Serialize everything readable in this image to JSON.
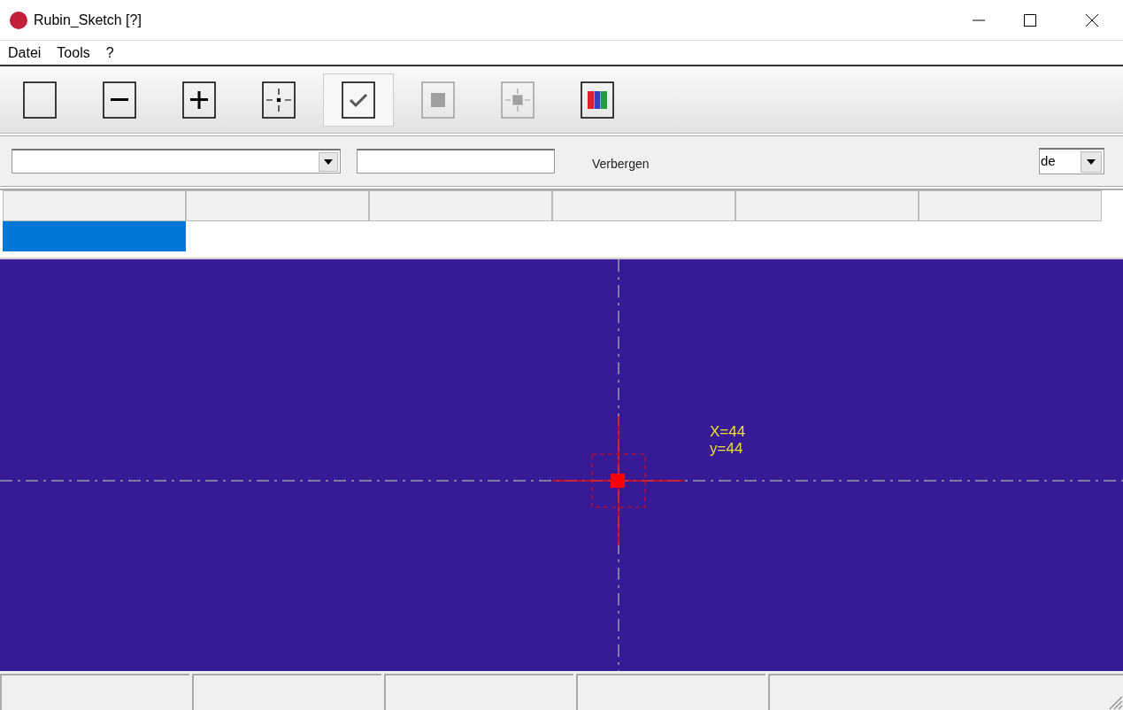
{
  "window": {
    "title": "Rubin_Sketch [?]"
  },
  "menu": [
    "Datei",
    "Tools",
    "?"
  ],
  "toolbar": [
    {
      "kind": "empty",
      "selected": false,
      "disabled": false
    },
    {
      "kind": "minus",
      "selected": false,
      "disabled": false
    },
    {
      "kind": "plus",
      "selected": false,
      "disabled": false
    },
    {
      "kind": "crosshair",
      "selected": false,
      "disabled": false
    },
    {
      "kind": "check",
      "selected": true,
      "disabled": false
    },
    {
      "kind": "square",
      "selected": false,
      "disabled": true
    },
    {
      "kind": "crosshair-square",
      "selected": false,
      "disabled": true
    },
    {
      "kind": "colors",
      "selected": false,
      "disabled": false
    }
  ],
  "filter_bar": {
    "label": "Verbergen",
    "language": "de"
  },
  "grid": {
    "row_cells": [
      {
        "selected": true
      },
      {
        "selected": false
      },
      {
        "selected": false
      },
      {
        "selected": false
      },
      {
        "selected": false
      },
      {
        "selected": false
      }
    ]
  },
  "canvas": {
    "cursor_x": "X=44",
    "cursor_y": "y=44"
  }
}
